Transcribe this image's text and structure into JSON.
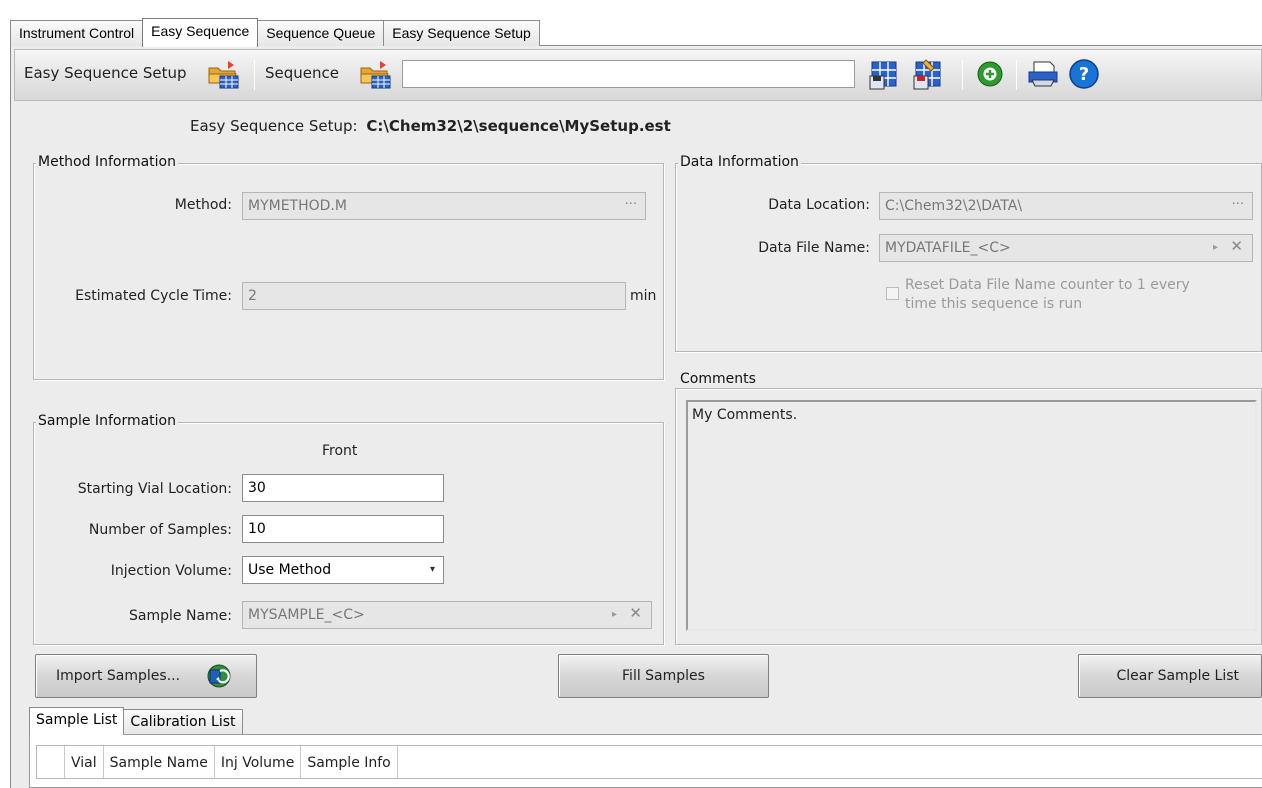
{
  "tabs": [
    {
      "label": "Instrument Control",
      "active": false
    },
    {
      "label": "Easy Sequence",
      "active": true
    },
    {
      "label": "Sequence Queue",
      "active": false
    },
    {
      "label": "Easy Sequence Setup",
      "active": false
    }
  ],
  "toolbar": {
    "setup_label": "Easy Sequence Setup",
    "sequence_label": "Sequence",
    "sequence_value": "",
    "icons": [
      "folder-open-icon",
      "folder-open-icon",
      "save-sequence-icon",
      "save-as-icon",
      "add-green-icon",
      "print-icon",
      "help-icon"
    ]
  },
  "header": {
    "prefix": "Easy Sequence Setup:",
    "path": "C:\\Chem32\\2\\sequence\\MySetup.est"
  },
  "method_info": {
    "title": "Method Information",
    "method_label": "Method:",
    "method_value": "MYMETHOD.M",
    "ellipsis": "···",
    "cycle_label": "Estimated Cycle Time:",
    "cycle_value": "2",
    "cycle_unit": "min"
  },
  "data_info": {
    "title": "Data Information",
    "location_label": "Data Location:",
    "location_value": "C:\\Chem32\\2\\DATA\\",
    "ellipsis": "···",
    "filename_label": "Data File Name:",
    "filename_value": "MYDATAFILE_<C>",
    "reset_text_1": "Reset Data File Name counter to 1 every",
    "reset_text_2": "time this sequence is run",
    "reset_checked": false
  },
  "comments": {
    "title": "Comments",
    "text": "My Comments."
  },
  "sample_info": {
    "title": "Sample Information",
    "column_head": "Front",
    "vial_label": "Starting Vial Location:",
    "vial_value": "30",
    "count_label": "Number of Samples:",
    "count_value": "10",
    "volume_label": "Injection Volume:",
    "volume_value": "Use Method",
    "name_label": "Sample Name:",
    "name_value": "MYSAMPLE_<C>"
  },
  "buttons": {
    "import": "Import Samples...",
    "fill": "Fill Samples",
    "clear": "Clear Sample List"
  },
  "bottom_tabs": [
    {
      "label": "Sample List",
      "active": true
    },
    {
      "label": "Calibration List",
      "active": false
    }
  ],
  "grid": {
    "columns": [
      "Vial",
      "Sample Name",
      "Inj Volume",
      "Sample Info"
    ]
  },
  "colors": {
    "panel": "#ececec",
    "help_blue": "#1a73d6",
    "add_green": "#2f9a2f"
  }
}
